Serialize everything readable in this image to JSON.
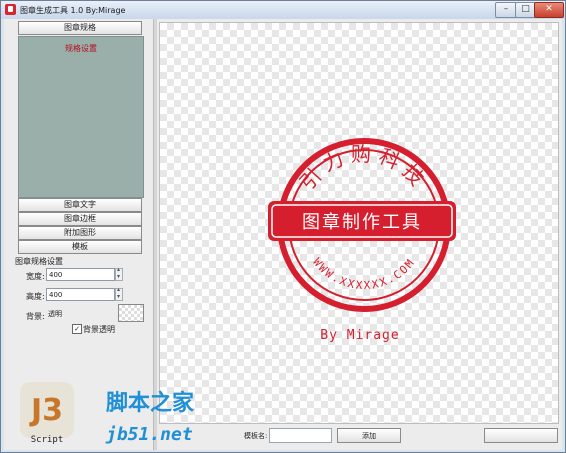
{
  "window": {
    "title": "图章生成工具 1.0    By:Mirage"
  },
  "left_panel": {
    "spec_tab": "图章规格",
    "spec_title": "规格设置",
    "sections": [
      "图章文字",
      "图章边框",
      "附加图形",
      "模板"
    ]
  },
  "form": {
    "title": "图章规格设置",
    "width_label": "宽度:",
    "width_value": "400",
    "height_label": "高度:",
    "height_value": "400",
    "bg_label": "背景:",
    "bg_value": "透明",
    "transparent_label": "背景透明",
    "transparent_checked": true
  },
  "stamp": {
    "top_text": "引力购科技",
    "banner_text": "图章制作工具",
    "bottom_text": "WWW.XXXXXX.COM",
    "author_text": "By Mirage",
    "color": "#d61f2e"
  },
  "bottom": {
    "template_label": "模板名:",
    "add_button": "添加"
  },
  "watermark": {
    "logo_text": "J3",
    "script_text": "Script",
    "site_cn": "脚本之家",
    "site_domain": "jb51.net",
    "brand_color": "#1f8fd6"
  }
}
